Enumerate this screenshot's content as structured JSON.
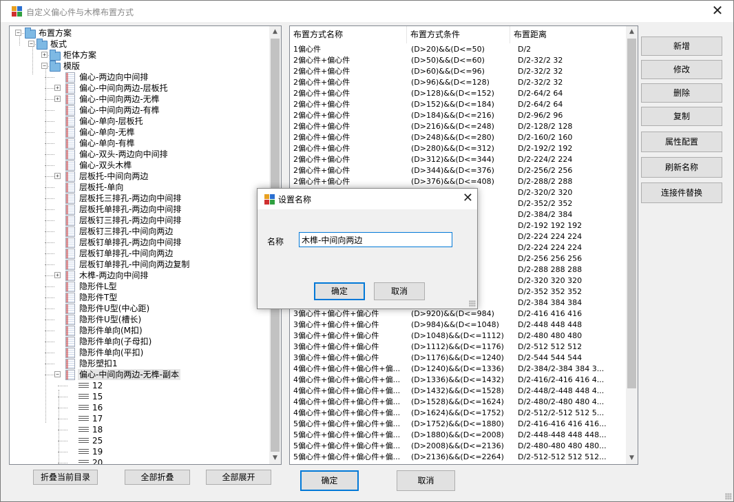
{
  "window": {
    "title": "自定义偏心件与木榫布置方式",
    "close_glyph": "✕"
  },
  "tree": {
    "nodes": [
      {
        "label": "布置方案",
        "level": 0,
        "expander": "−",
        "icon": "folder"
      },
      {
        "label": "板式",
        "level": 1,
        "expander": "−",
        "icon": "folder"
      },
      {
        "label": "柜体方案",
        "level": 2,
        "expander": "+",
        "icon": "folder"
      },
      {
        "label": "模版",
        "level": 2,
        "expander": "−",
        "icon": "folder"
      },
      {
        "label": "偏心-两边向中间排",
        "level": 3,
        "expander": "",
        "icon": "doc"
      },
      {
        "label": "偏心-中间向两边-层板托",
        "level": 3,
        "expander": "+",
        "icon": "doc"
      },
      {
        "label": "偏心-中间向两边-无榫",
        "level": 3,
        "expander": "+",
        "icon": "doc"
      },
      {
        "label": "偏心-中间向两边-有榫",
        "level": 3,
        "expander": "",
        "icon": "doc"
      },
      {
        "label": "偏心-单向-层板托",
        "level": 3,
        "expander": "",
        "icon": "doc"
      },
      {
        "label": "偏心-单向-无榫",
        "level": 3,
        "expander": "",
        "icon": "doc"
      },
      {
        "label": "偏心-单向-有榫",
        "level": 3,
        "expander": "",
        "icon": "doc"
      },
      {
        "label": "偏心-双头-两边向中间排",
        "level": 3,
        "expander": "",
        "icon": "doc"
      },
      {
        "label": "偏心-双头木榫",
        "level": 3,
        "expander": "",
        "icon": "doc"
      },
      {
        "label": "层板托-中间向两边",
        "level": 3,
        "expander": "+",
        "icon": "doc"
      },
      {
        "label": "层板托-单向",
        "level": 3,
        "expander": "",
        "icon": "doc"
      },
      {
        "label": "层板托三排孔-两边向中间排",
        "level": 3,
        "expander": "",
        "icon": "doc"
      },
      {
        "label": "层板托单排孔-两边向中间排",
        "level": 3,
        "expander": "",
        "icon": "doc"
      },
      {
        "label": "层板钉三排孔-两边向中间排",
        "level": 3,
        "expander": "",
        "icon": "doc"
      },
      {
        "label": "层板钉三排孔-中间向两边",
        "level": 3,
        "expander": "",
        "icon": "doc"
      },
      {
        "label": "层板钉单排孔-两边向中间排",
        "level": 3,
        "expander": "",
        "icon": "doc"
      },
      {
        "label": "层板钉单排孔-中间向两边",
        "level": 3,
        "expander": "",
        "icon": "doc"
      },
      {
        "label": "层板钉单排孔-中间向两边复制",
        "level": 3,
        "expander": "",
        "icon": "doc"
      },
      {
        "label": "木榫-两边向中间排",
        "level": 3,
        "expander": "+",
        "icon": "doc"
      },
      {
        "label": "隐形件L型",
        "level": 3,
        "expander": "",
        "icon": "doc"
      },
      {
        "label": "隐形件T型",
        "level": 3,
        "expander": "",
        "icon": "doc"
      },
      {
        "label": "隐形件U型(中心距)",
        "level": 3,
        "expander": "",
        "icon": "doc"
      },
      {
        "label": "隐形件U型(槽长)",
        "level": 3,
        "expander": "",
        "icon": "doc"
      },
      {
        "label": "隐形件单向(M扣)",
        "level": 3,
        "expander": "",
        "icon": "doc"
      },
      {
        "label": "隐形件单向(子母扣)",
        "level": 3,
        "expander": "",
        "icon": "doc"
      },
      {
        "label": "隐形件单向(平扣)",
        "level": 3,
        "expander": "",
        "icon": "doc"
      },
      {
        "label": "隐形塑扣1",
        "level": 3,
        "expander": "",
        "icon": "doc"
      },
      {
        "label": "偏心-中间向两边-无榫-副本",
        "level": 3,
        "expander": "−",
        "icon": "doc",
        "selected": true
      },
      {
        "label": "12",
        "level": 4,
        "expander": "",
        "icon": "line"
      },
      {
        "label": "15",
        "level": 4,
        "expander": "",
        "icon": "line"
      },
      {
        "label": "16",
        "level": 4,
        "expander": "",
        "icon": "line"
      },
      {
        "label": "17",
        "level": 4,
        "expander": "",
        "icon": "line"
      },
      {
        "label": "18",
        "level": 4,
        "expander": "",
        "icon": "line"
      },
      {
        "label": "25",
        "level": 4,
        "expander": "",
        "icon": "line"
      },
      {
        "label": "19",
        "level": 4,
        "expander": "",
        "icon": "line"
      },
      {
        "label": "20",
        "level": 4,
        "expander": "",
        "icon": "line"
      }
    ],
    "scroll_up": "▲",
    "scroll_down": "▼"
  },
  "tree_buttons": {
    "collapse_current": "折叠当前目录",
    "collapse_all": "全部折叠",
    "expand_all": "全部展开"
  },
  "list": {
    "columns": [
      "布置方式名称",
      "布置方式条件",
      "布置距离"
    ],
    "rows": [
      [
        "1偏心件",
        "(D>20)&&(D<=50)",
        "D/2"
      ],
      [
        "2偏心件+偏心件",
        "(D>50)&&(D<=60)",
        "D/2-32/2 32"
      ],
      [
        "2偏心件+偏心件",
        "(D>60)&&(D<=96)",
        "D/2-32/2 32"
      ],
      [
        "2偏心件+偏心件",
        "(D>96)&&(D<=128)",
        "D/2-32/2 32"
      ],
      [
        "2偏心件+偏心件",
        "(D>128)&&(D<=152)",
        "D/2-64/2 64"
      ],
      [
        "2偏心件+偏心件",
        "(D>152)&&(D<=184)",
        "D/2-64/2 64"
      ],
      [
        "2偏心件+偏心件",
        "(D>184)&&(D<=216)",
        "D/2-96/2 96"
      ],
      [
        "2偏心件+偏心件",
        "(D>216)&&(D<=248)",
        "D/2-128/2 128"
      ],
      [
        "2偏心件+偏心件",
        "(D>248)&&(D<=280)",
        "D/2-160/2 160"
      ],
      [
        "2偏心件+偏心件",
        "(D>280)&&(D<=312)",
        "D/2-192/2 192"
      ],
      [
        "2偏心件+偏心件",
        "(D>312)&&(D<=344)",
        "D/2-224/2 224"
      ],
      [
        "2偏心件+偏心件",
        "(D>344)&&(D<=376)",
        "D/2-256/2 256"
      ],
      [
        "2偏心件+偏心件",
        "(D>376)&&(D<=408)",
        "D/2-288/2 288"
      ],
      [
        "",
        "",
        "D/2-320/2 320"
      ],
      [
        "",
        "",
        "D/2-352/2 352"
      ],
      [
        "",
        "",
        "D/2-384/2 384"
      ],
      [
        "",
        "",
        "D/2-192 192 192"
      ],
      [
        "",
        "",
        "D/2-224 224 224"
      ],
      [
        "",
        "",
        "D/2-224 224 224"
      ],
      [
        "",
        "",
        "D/2-256 256 256"
      ],
      [
        "",
        "",
        "D/2-288 288 288"
      ],
      [
        "",
        "",
        "D/2-320 320 320"
      ],
      [
        "",
        "",
        "D/2-352 352 352"
      ],
      [
        "",
        "",
        "D/2-384 384 384"
      ],
      [
        "3偏心件+偏心件+偏心件",
        "(D>920)&&(D<=984)",
        "D/2-416 416 416"
      ],
      [
        "3偏心件+偏心件+偏心件",
        "(D>984)&&(D<=1048)",
        "D/2-448 448 448"
      ],
      [
        "3偏心件+偏心件+偏心件",
        "(D>1048)&&(D<=1112)",
        "D/2-480 480 480"
      ],
      [
        "3偏心件+偏心件+偏心件",
        "(D>1112)&&(D<=1176)",
        "D/2-512 512 512"
      ],
      [
        "3偏心件+偏心件+偏心件",
        "(D>1176)&&(D<=1240)",
        "D/2-544 544 544"
      ],
      [
        "4偏心件+偏心件+偏心件+偏...",
        "(D>1240)&&(D<=1336)",
        "D/2-384/2-384 384 3..."
      ],
      [
        "4偏心件+偏心件+偏心件+偏...",
        "(D>1336)&&(D<=1432)",
        "D/2-416/2-416 416 4..."
      ],
      [
        "4偏心件+偏心件+偏心件+偏...",
        "(D>1432)&&(D<=1528)",
        "D/2-448/2-448 448 4..."
      ],
      [
        "4偏心件+偏心件+偏心件+偏...",
        "(D>1528)&&(D<=1624)",
        "D/2-480/2-480 480 4..."
      ],
      [
        "4偏心件+偏心件+偏心件+偏...",
        "(D>1624)&&(D<=1752)",
        "D/2-512/2-512 512 5..."
      ],
      [
        "5偏心件+偏心件+偏心件+偏...",
        "(D>1752)&&(D<=1880)",
        "D/2-416-416 416 416..."
      ],
      [
        "5偏心件+偏心件+偏心件+偏...",
        "(D>1880)&&(D<=2008)",
        "D/2-448-448 448 448..."
      ],
      [
        "5偏心件+偏心件+偏心件+偏...",
        "(D>2008)&&(D<=2136)",
        "D/2-480-480 480 480..."
      ],
      [
        "5偏心件+偏心件+偏心件+偏...",
        "(D>2136)&&(D<=2264)",
        "D/2-512-512 512 512..."
      ]
    ],
    "scroll_up": "▲",
    "scroll_down": "▼"
  },
  "side_buttons": {
    "add": "新增",
    "edit": "修改",
    "delete": "删除",
    "copy": "复制",
    "properties": "属性配置",
    "refresh_name": "刷新名称",
    "connector_replace": "连接件替换"
  },
  "bottom_buttons": {
    "ok": "确定",
    "cancel": "取消"
  },
  "dialog": {
    "title": "设置名称",
    "close_glyph": "✕",
    "name_label": "名称",
    "name_value": "木榫-中间向两边",
    "ok": "确定",
    "cancel": "取消"
  },
  "colors": {
    "accent": "#0078d7",
    "selected_row": "#e5e5e5"
  }
}
